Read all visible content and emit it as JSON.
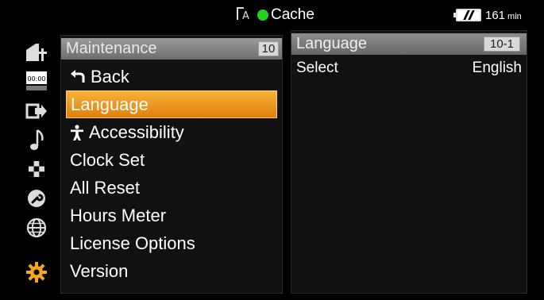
{
  "topbar": {
    "media_letter": "A",
    "media_status_color": "#1fd41f",
    "cache_label": "Cache",
    "battery_value": "161",
    "battery_unit": "min"
  },
  "side_icons": [
    {
      "name": "camera-icon"
    },
    {
      "name": "timecode-icon",
      "text": "00:00"
    },
    {
      "name": "output-icon"
    },
    {
      "name": "audio-note-icon"
    },
    {
      "name": "checker-icon"
    },
    {
      "name": "wrench-icon"
    },
    {
      "name": "globe-icon"
    },
    {
      "name": "gear-icon",
      "color": "#f5a623"
    }
  ],
  "menu": {
    "header": {
      "title": "Maintenance",
      "badge": "10"
    },
    "items": [
      {
        "label": "Back",
        "icon": "back-arrow-icon"
      },
      {
        "label": "Language",
        "selected": true
      },
      {
        "label": "Accessibility",
        "icon": "accessibility-icon"
      },
      {
        "label": "Clock Set"
      },
      {
        "label": "All Reset"
      },
      {
        "label": "Hours Meter"
      },
      {
        "label": "License Options"
      },
      {
        "label": "Version"
      }
    ],
    "selected_color": "#f0a020"
  },
  "detail": {
    "header": {
      "title": "Language",
      "badge": "10-1"
    },
    "row": {
      "label": "Select",
      "value": "English"
    }
  }
}
